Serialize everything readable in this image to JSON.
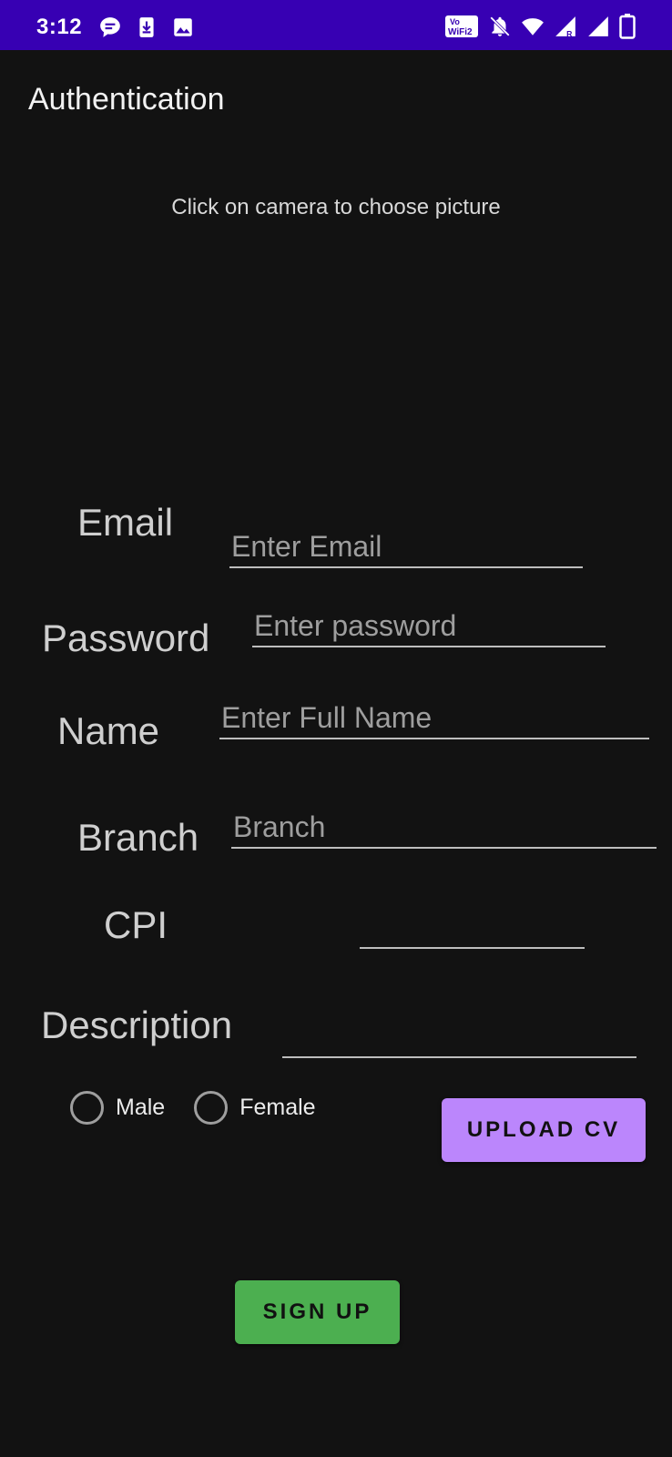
{
  "status_bar": {
    "time": "3:12",
    "background": "#3700b3",
    "left_icons": [
      "chat-bubble-icon",
      "download-icon",
      "image-icon"
    ],
    "right_icons": [
      "vowifi-icon",
      "bell-off-icon",
      "wifi-icon",
      "signal-icon",
      "signal-icon",
      "battery-icon"
    ],
    "vowifi_label": "VoWiFi2"
  },
  "app_bar": {
    "title": "Authentication"
  },
  "hint": "Click on camera to choose picture",
  "form": {
    "email": {
      "label": "Email",
      "placeholder": "Enter Email",
      "value": ""
    },
    "password": {
      "label": "Password",
      "placeholder": "Enter password",
      "value": ""
    },
    "name": {
      "label": "Name",
      "placeholder": "Enter Full Name",
      "value": ""
    },
    "branch": {
      "label": "Branch",
      "placeholder": "Branch",
      "value": ""
    },
    "cpi": {
      "label": "CPI",
      "placeholder": "",
      "value": ""
    },
    "description": {
      "label": "Description",
      "placeholder": "",
      "value": ""
    }
  },
  "gender": {
    "options": [
      {
        "label": "Male",
        "selected": false
      },
      {
        "label": "Female",
        "selected": false
      }
    ]
  },
  "buttons": {
    "upload_cv": "UPLOAD CV",
    "sign_up": "SIGN UP"
  },
  "colors": {
    "background": "#121212",
    "upload_button": "#bb86fc",
    "signup_button": "#4caf50"
  }
}
